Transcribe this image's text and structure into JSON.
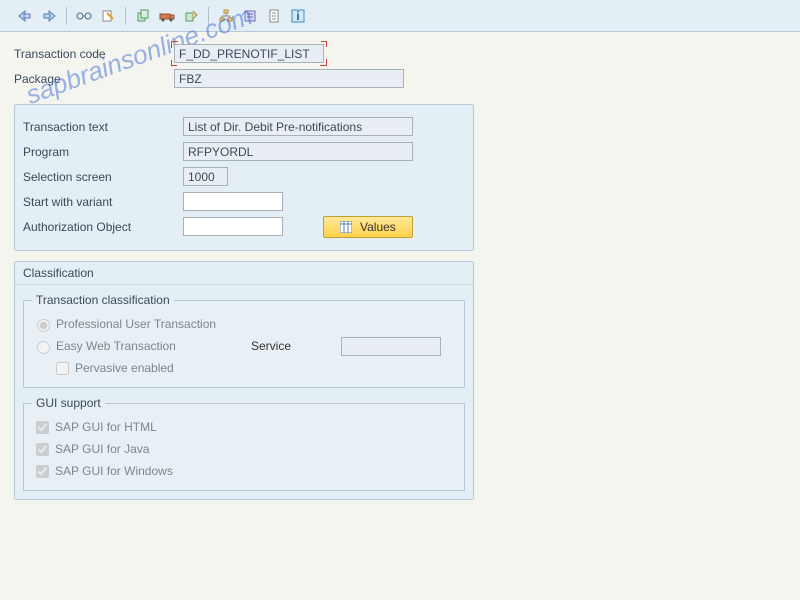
{
  "watermark": "sapbrainsonline.com",
  "fields": {
    "tcode_label": "Transaction code",
    "tcode_value": "F_DD_PRENOTIF_LIST",
    "package_label": "Package",
    "package_value": "FBZ",
    "ttext_label": "Transaction text",
    "ttext_value": "List of Dir. Debit Pre-notifications",
    "program_label": "Program",
    "program_value": "RFPYORDL",
    "selscreen_label": "Selection screen",
    "selscreen_value": "1000",
    "startvariant_label": "Start with variant",
    "startvariant_value": "",
    "authobj_label": "Authorization Object",
    "authobj_value": "",
    "values_btn": "Values"
  },
  "classification": {
    "title": "Classification",
    "trans_class_title": "Transaction classification",
    "radio_prof": "Professional User Transaction",
    "radio_easy": "Easy Web Transaction",
    "service_label": "Service",
    "service_value": "",
    "pervasive": "Pervasive enabled",
    "gui_title": "GUI support",
    "gui_html": "SAP GUI for HTML",
    "gui_java": "SAP GUI for Java",
    "gui_win": "SAP GUI for Windows"
  }
}
